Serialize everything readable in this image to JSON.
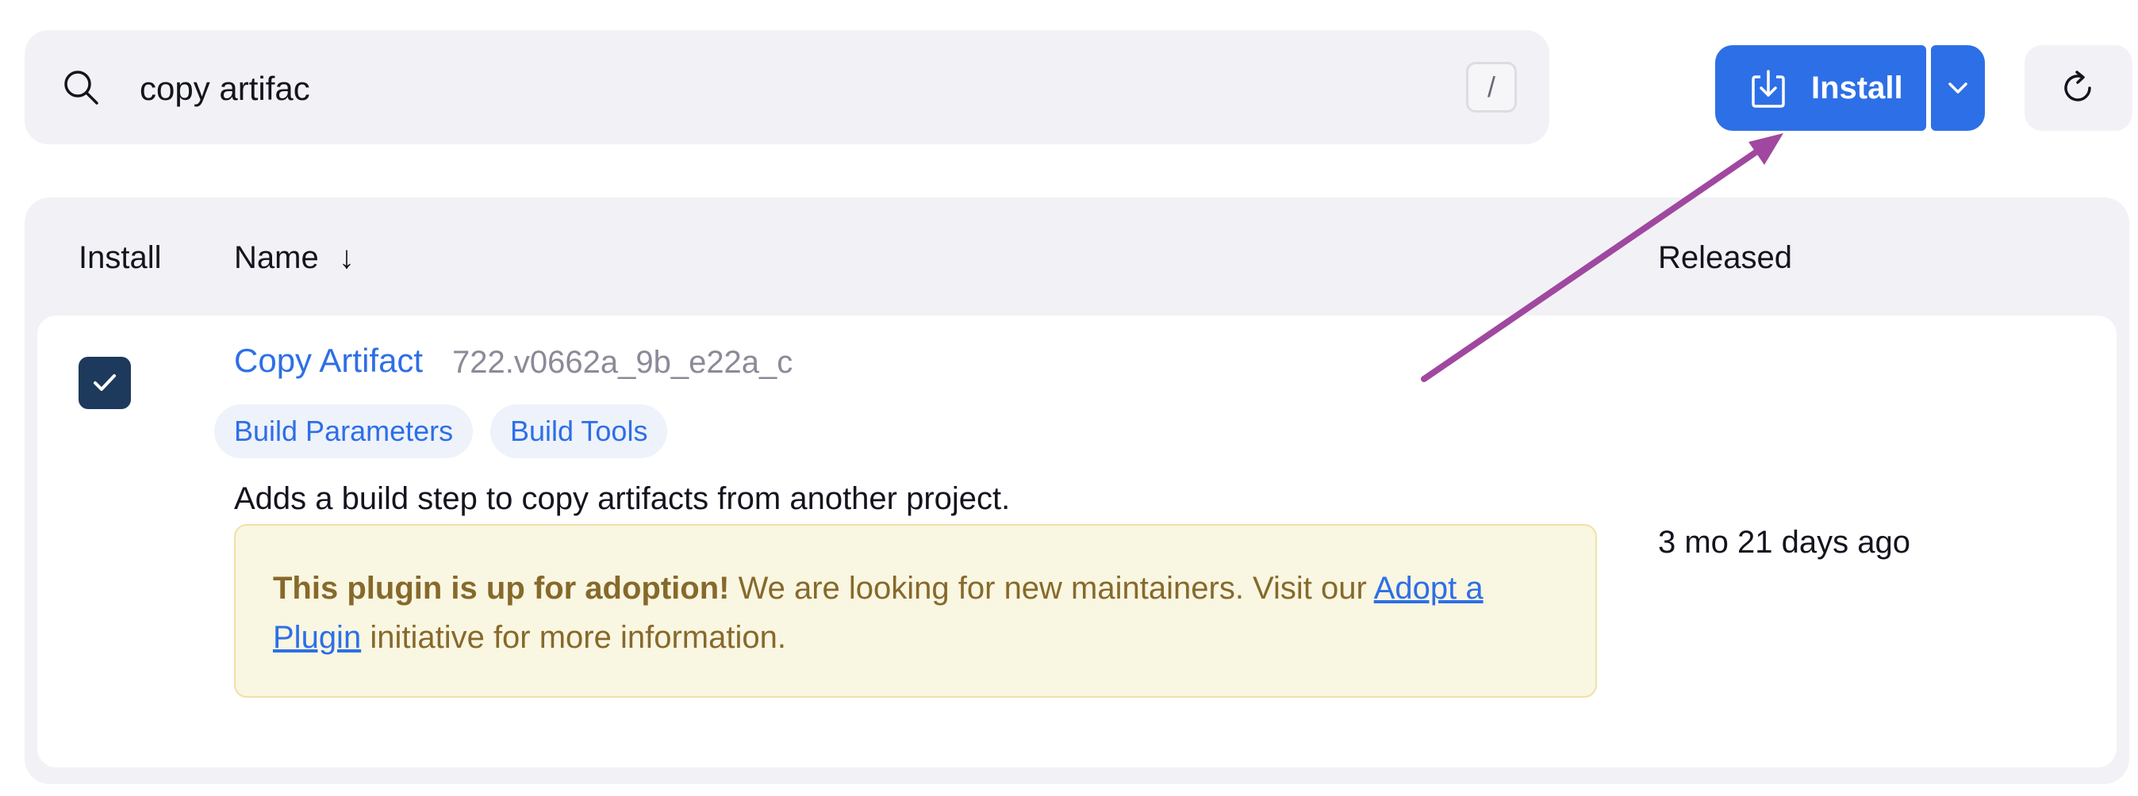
{
  "search": {
    "value": "copy artifac",
    "shortcut_key": "/"
  },
  "toolbar": {
    "install_label": "Install",
    "install_icon": "download-icon",
    "dropdown_icon": "chevron-down-icon",
    "refresh_icon": "refresh-icon"
  },
  "table": {
    "columns": {
      "install": "Install",
      "name": "Name",
      "name_sort_indicator": "↓",
      "released": "Released"
    },
    "rows": [
      {
        "checked": true,
        "title": "Copy Artifact",
        "version": "722.v0662a_9b_e22a_c",
        "tags": [
          "Build Parameters",
          "Build Tools"
        ],
        "description": "Adds a build step to copy artifacts from another project.",
        "notice": {
          "bold": "This plugin is up for adoption!",
          "text_before_link": " We are looking for new maintainers. Visit our ",
          "link_text": "Adopt a Plugin",
          "text_after_link": " initiative for more information."
        },
        "released": "3 mo 21 days ago"
      }
    ]
  },
  "colors": {
    "accent": "#2d6fe6",
    "checkbox": "#1d3a5c",
    "notice_background": "#f9f6e1",
    "notice_text": "#86692b",
    "annotation_arrow": "#a0489f"
  }
}
